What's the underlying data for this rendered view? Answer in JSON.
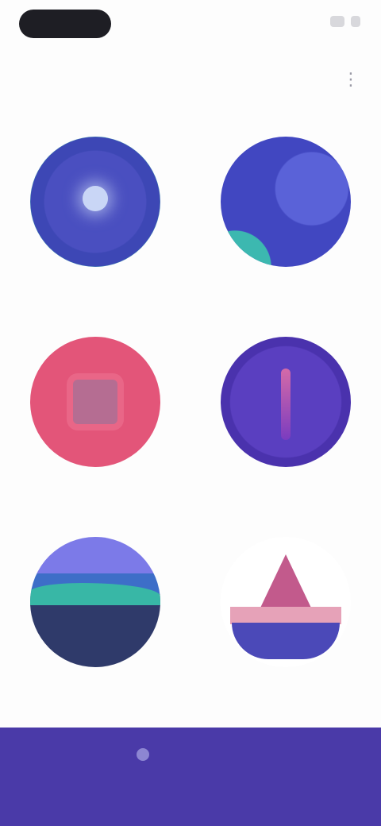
{
  "status_bar": {
    "icons": [
      "signal-icon",
      "battery-icon"
    ]
  },
  "header": {
    "title": "",
    "action_icon": "more-icon"
  },
  "grid": {
    "items": [
      {
        "label": "",
        "icon": "star-icon"
      },
      {
        "label": "",
        "icon": "wave-icon"
      },
      {
        "label": "",
        "icon": "square-icon"
      },
      {
        "label": "",
        "icon": "beam-icon"
      },
      {
        "label": "",
        "icon": "hills-icon"
      },
      {
        "label": "",
        "icon": "mountain-icon"
      }
    ]
  },
  "bottom_nav": {
    "items": [
      {
        "label": "",
        "icon": "home-icon"
      }
    ]
  },
  "colors": {
    "accent": "#4a3aa8",
    "teal": "#3cb8b0",
    "pink": "#e35579",
    "purple": "#5a3fc0"
  }
}
